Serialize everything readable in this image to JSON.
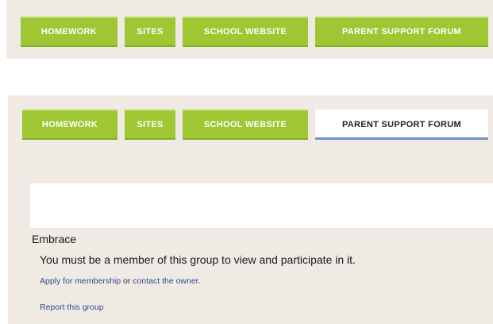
{
  "nav_top": {
    "tabs": [
      {
        "label": "HOMEWORK"
      },
      {
        "label": "SITES"
      },
      {
        "label": "SCHOOL WEBSITE"
      },
      {
        "label": "PARENT SUPPORT FORUM"
      }
    ]
  },
  "nav_bottom": {
    "tabs": [
      {
        "label": "HOMEWORK"
      },
      {
        "label": "SITES"
      },
      {
        "label": "SCHOOL WEBSITE"
      },
      {
        "label": "PARENT SUPPORT FORUM",
        "active": true
      }
    ]
  },
  "group": {
    "name": "Embrace",
    "message": "You must be a member of this group to view and participate in it.",
    "apply_link": "Apply for membership",
    "or_text": " or ",
    "contact_link": "contact the owner.",
    "report_link": "Report this group"
  },
  "colors": {
    "tab_green": "#9ec733",
    "active_underline": "#6f93c8",
    "link_blue": "#2f4f8f",
    "panel_bg": "#efeae3"
  }
}
